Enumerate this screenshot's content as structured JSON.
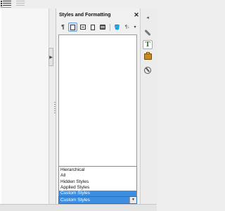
{
  "sidebar": {
    "title": "Styles and Formatting",
    "close_glyph": "✕",
    "tabs": [
      {
        "name": "menu",
        "icon": "sidebar-menu-icon",
        "glyph": "◂"
      },
      {
        "name": "properties",
        "icon": "wrench-icon"
      },
      {
        "name": "styles",
        "icon": "styles-t-icon",
        "glyph": "T",
        "active": true
      },
      {
        "name": "gallery",
        "icon": "gallery-icon"
      },
      {
        "name": "navigator",
        "icon": "navigator-icon"
      }
    ]
  },
  "toolbar": {
    "buttons": [
      {
        "name": "paragraph-styles",
        "glyph": "¶",
        "active": false
      },
      {
        "name": "character-styles",
        "glyph": "a",
        "active": true
      },
      {
        "name": "frame-styles",
        "active": false
      },
      {
        "name": "page-styles",
        "active": false
      },
      {
        "name": "list-styles",
        "active": false
      }
    ],
    "fill_format_glyph": "🪣",
    "new_style_glyph": "¶↓",
    "more_glyph": "▾"
  },
  "filter": {
    "options": [
      "Hierarchical",
      "All",
      "Hidden Styles",
      "Applied Styles",
      "Custom Styles"
    ],
    "highlighted_index": 4,
    "selected": "Custom Styles",
    "arrow_glyph": "▼"
  },
  "doc": {
    "collapse_glyph": "▶"
  },
  "colors": {
    "selection": "#3d8ee0",
    "active_button": "#d6e4f5",
    "styles_icon": "#2a7c2a"
  }
}
